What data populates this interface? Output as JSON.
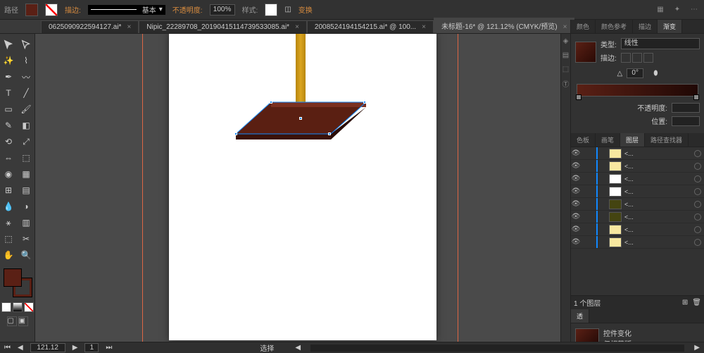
{
  "topbar": {
    "path_label": "路径",
    "stroke_label": "描边:",
    "stroke_style": "基本",
    "opacity_label": "不透明度:",
    "opacity_value": "100%",
    "style_label": "样式:",
    "transform_label": "变换"
  },
  "tabs": [
    {
      "label": "0625090922594127.ai*",
      "active": false
    },
    {
      "label": "Nipic_22289708_20190415114739533085.ai*",
      "active": false
    },
    {
      "label": "20085241941542​15.ai* @ 100...",
      "active": false
    },
    {
      "label": "未标题-16* @ 121.12% (CMYK/预览)",
      "active": true
    }
  ],
  "panels": {
    "color_tabs": [
      "颜色",
      "颜色参考",
      "描边",
      "渐变"
    ],
    "type_label": "类型:",
    "type_value": "线性",
    "stroke_mini": "描边:",
    "angle_label": "△",
    "angle_value": "0°",
    "opacity_label": "不透明度:",
    "location_label": "位置:",
    "layer_tabs": [
      "色板",
      "画笔",
      "图层",
      "路径查找器"
    ],
    "layer_footer": "1 个图层",
    "trans_tab": "透",
    "control_label": "控件变化",
    "mask_label": "仅相蒙版"
  },
  "layers": [
    {
      "thumb": "#f8e8a0"
    },
    {
      "thumb": "#f8e8a0"
    },
    {
      "thumb": "#fff"
    },
    {
      "thumb": "#fff"
    },
    {
      "thumb": "#441"
    },
    {
      "thumb": "#441"
    },
    {
      "thumb": "#f8e8a0"
    },
    {
      "thumb": "#f8e8a0"
    }
  ],
  "layer_name": "<...",
  "status": {
    "zoom": "121.12",
    "page": "1",
    "mode": "选择"
  }
}
